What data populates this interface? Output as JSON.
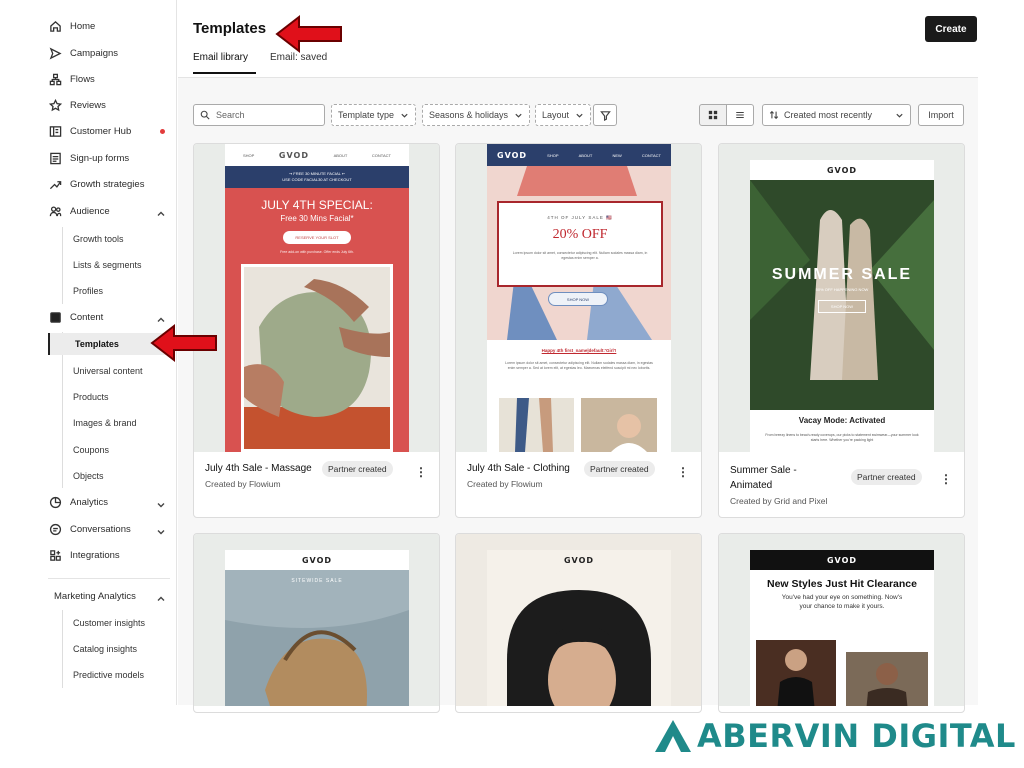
{
  "sidebar": {
    "items": [
      {
        "label": "Home",
        "icon": "home-icon"
      },
      {
        "label": "Campaigns",
        "icon": "send-icon"
      },
      {
        "label": "Flows",
        "icon": "flows-icon"
      },
      {
        "label": "Reviews",
        "icon": "star-icon"
      },
      {
        "label": "Customer Hub",
        "icon": "hub-icon"
      },
      {
        "label": "Sign-up forms",
        "icon": "form-icon"
      },
      {
        "label": "Growth strategies",
        "icon": "trend-icon"
      },
      {
        "label": "Audience",
        "icon": "people-icon"
      },
      {
        "label": "Content",
        "icon": "content-icon"
      },
      {
        "label": "Analytics",
        "icon": "analytics-icon"
      },
      {
        "label": "Conversations",
        "icon": "chat-icon"
      },
      {
        "label": "Integrations",
        "icon": "integrations-icon"
      },
      {
        "label": "Marketing Analytics",
        "icon": ""
      }
    ],
    "audience_sub": [
      "Growth tools",
      "Lists & segments",
      "Profiles"
    ],
    "content_sub": [
      "Templates",
      "Universal content",
      "Products",
      "Images & brand",
      "Coupons",
      "Objects"
    ],
    "marketing_sub": [
      "Customer insights",
      "Catalog insights",
      "Predictive models"
    ],
    "notification_color": "#e23b3b"
  },
  "header": {
    "title": "Templates",
    "tabs": [
      "Email library",
      "Email: saved"
    ],
    "create_label": "Create"
  },
  "toolbar": {
    "search_placeholder": "Search",
    "filters": [
      "Template type",
      "Seasons & holidays",
      "Layout"
    ],
    "sort_label": "Created most recently",
    "import_label": "Import"
  },
  "cards": [
    {
      "title": "July 4th Sale - Massage",
      "badge": "Partner created",
      "creator": "Created by Flowium",
      "email": {
        "nav": [
          "SHOP",
          "ABOUT",
          "CONTACT"
        ],
        "logo": "GVOD",
        "banner": "⇝ FREE 30 MINUTE FACIAL ⇜",
        "banner2": "USE CODE FACIAL30 AT CHECKOUT",
        "headline": "JULY 4TH SPECIAL:",
        "subhead": "Free 30 Mins Facial*",
        "cta": "RESERVE YOUR SLOT",
        "fine": "Free add-on with purchase. Offer ends July 6th."
      }
    },
    {
      "title": "July 4th Sale - Clothing",
      "badge": "Partner created",
      "creator": "Created by Flowium",
      "email": {
        "logo": "GVOD",
        "nav": [
          "SHOP",
          "ABOUT",
          "NEW",
          "CONTACT"
        ],
        "eyebrow": "4TH OF JULY SALE 🇺🇸",
        "headline": "20% OFF",
        "body": "Lorem ipsum dolor sit amet, consectetur adipiscing elit. Nullam sodales massa diam, in egestas enim semper a.",
        "cta": "SHOP NOW",
        "tag": "Happy 4th first_name|default:'Girl'!",
        "body2": "Lorem ipsum dolor sit amet, consectetur adipiscing elit. Nullam sodales massa diam, in egestas enim semper a. Sed at lorem elit, at egestas leo. Maecenas eleifend suscipit mi nec lobortis."
      }
    },
    {
      "title": "Summer Sale - Animated",
      "badge": "Partner created",
      "creator": "Created by Grid and Pixel",
      "email": {
        "logo": "GVOD",
        "headline": "SUMMER SALE",
        "sub": "50% OFF HAPPENING NOW",
        "cta": "SHOP NOW",
        "section": "Vacay Mode: Activated",
        "body": "From breezy linens to beach-ready coverups, our picks to statement swimwear—your summer look starts here. Whether you're packing light"
      }
    },
    {
      "title": "",
      "badge": "",
      "creator": "",
      "email": {
        "logo": "GVOD",
        "headline": "SITEWIDE SALE"
      }
    },
    {
      "title": "",
      "badge": "",
      "creator": "",
      "email": {
        "logo": "GVOD"
      }
    },
    {
      "title": "",
      "badge": "",
      "creator": "",
      "email": {
        "logo": "GVOD",
        "headline": "New Styles Just Hit Clearance",
        "body": "You've had your eye on something. Now's your chance to make it yours."
      }
    }
  ],
  "brand": {
    "name": "ABERVIN DIGITAL",
    "color": "#1f8a8a"
  },
  "colors": {
    "primary_dark": "#1a1a1a",
    "arrow": "#e0101a",
    "july_red": "#d85250",
    "navy": "#2b3f6b"
  }
}
